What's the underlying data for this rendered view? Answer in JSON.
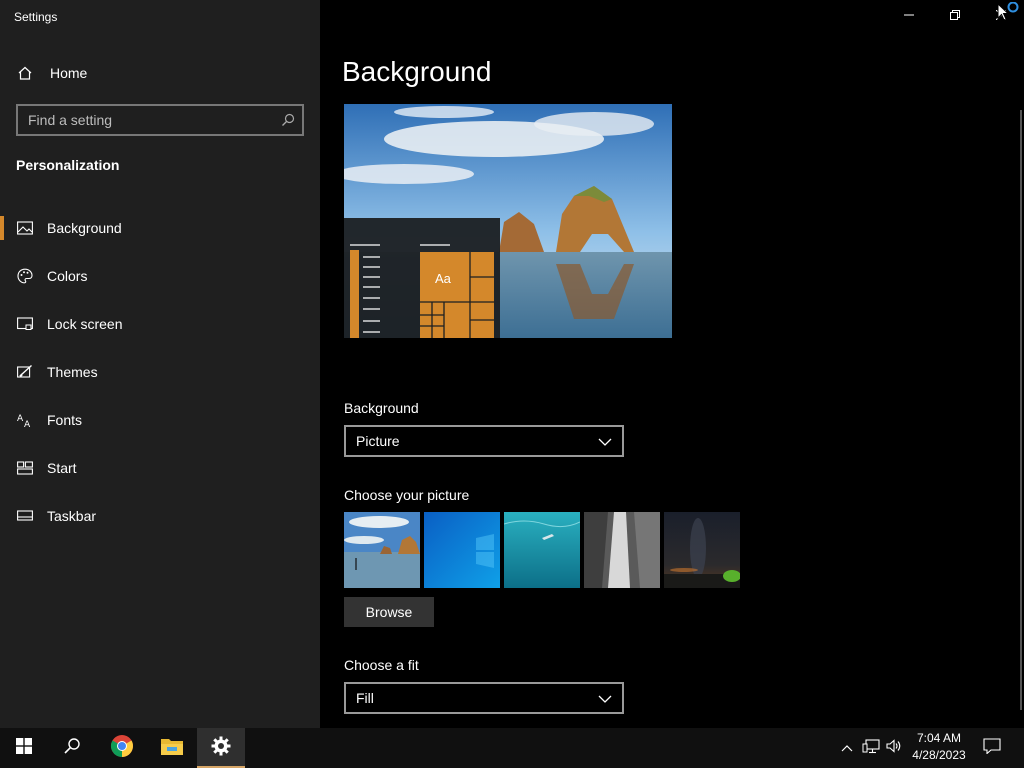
{
  "window": {
    "title": "Settings",
    "controls": [
      "minimize-icon",
      "restore-icon",
      "close-icon"
    ]
  },
  "sidebar": {
    "home_label": "Home",
    "search_placeholder": "Find a setting",
    "section_title": "Personalization",
    "items": [
      {
        "label": "Background",
        "icon": "picture-icon",
        "active": true
      },
      {
        "label": "Colors",
        "icon": "palette-icon",
        "active": false
      },
      {
        "label": "Lock screen",
        "icon": "lock-screen-icon",
        "active": false
      },
      {
        "label": "Themes",
        "icon": "themes-icon",
        "active": false
      },
      {
        "label": "Fonts",
        "icon": "fonts-icon",
        "active": false
      },
      {
        "label": "Start",
        "icon": "start-icon",
        "active": false
      },
      {
        "label": "Taskbar",
        "icon": "taskbar-icon",
        "active": false
      }
    ]
  },
  "main": {
    "page_title": "Background",
    "preview": {
      "tile_label": "Aa"
    },
    "background_label": "Background",
    "background_value": "Picture",
    "choose_picture_label": "Choose your picture",
    "pictures": [
      "beach-rock-arch",
      "windows-blue",
      "underwater-swimmer",
      "waterfall-cliff",
      "night-sky-tent"
    ],
    "browse_label": "Browse",
    "choose_fit_label": "Choose a fit",
    "fit_value": "Fill"
  },
  "taskbar": {
    "apps": [
      "start-icon",
      "search-icon",
      "chrome-icon",
      "file-explorer-icon",
      "settings-icon"
    ],
    "active_app": "settings-icon",
    "time": "7:04 AM",
    "date": "4/28/2023"
  },
  "colors": {
    "accent": "#d4882b",
    "sidebar_bg": "#1f1f1f",
    "main_bg": "#000000",
    "taskbar_bg": "#101010"
  }
}
